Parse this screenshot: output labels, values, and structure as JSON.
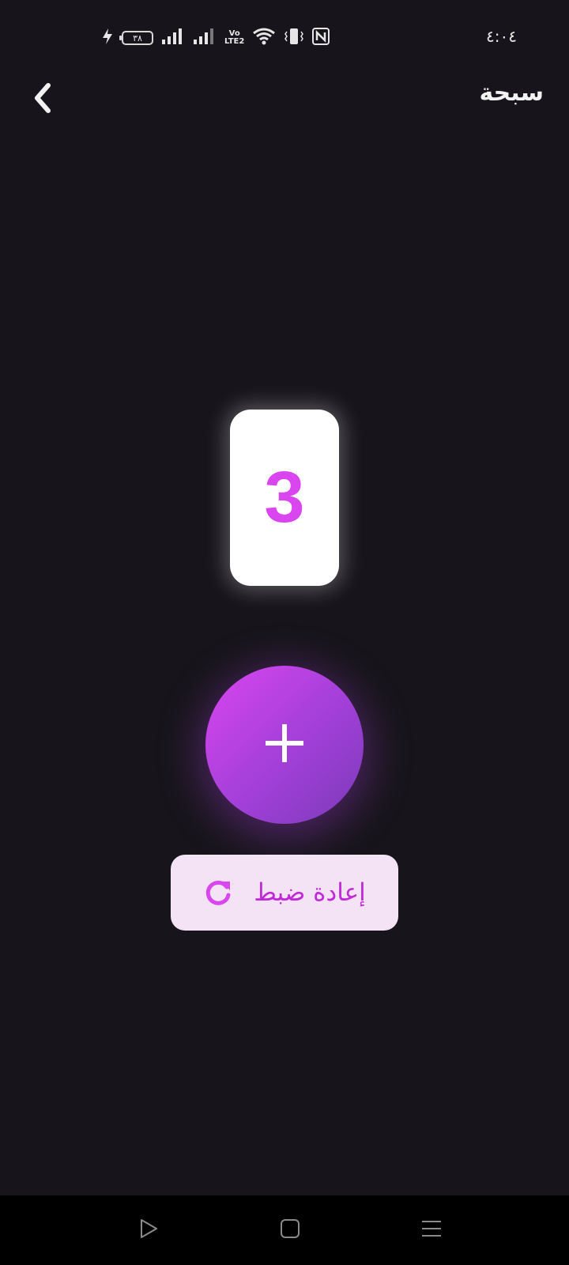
{
  "status_bar": {
    "time": "٤:٠٤",
    "battery_level": "٣٨"
  },
  "header": {
    "title": "سبحة"
  },
  "counter": {
    "value": "3"
  },
  "actions": {
    "reset_label": "إعادة ضبط"
  },
  "colors": {
    "background": "#17151b",
    "accent": "#d946ef",
    "accent_dark": "#7b3bb8",
    "reset_bg": "#f3e3f4"
  },
  "icons": {
    "back": "chevron-left-icon",
    "increment": "plus-icon",
    "reset": "refresh-icon",
    "nav_back": "triangle-back-icon",
    "nav_home": "square-home-icon",
    "nav_recents": "menu-recents-icon"
  }
}
